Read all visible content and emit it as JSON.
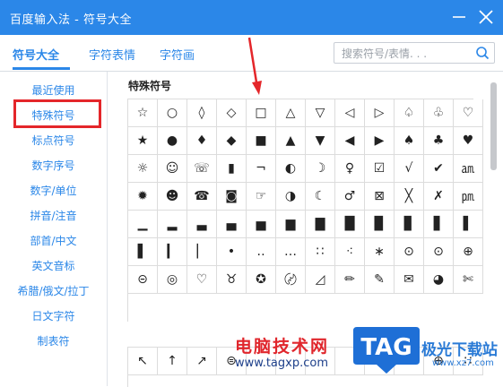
{
  "window": {
    "title": "百度输入法 - 符号大全"
  },
  "tabs": [
    {
      "label": "符号大全"
    },
    {
      "label": "字符表情"
    },
    {
      "label": "字符画"
    }
  ],
  "search": {
    "placeholder": "搜索符号/表情. . ."
  },
  "sidebar": {
    "items": [
      {
        "label": "最近使用"
      },
      {
        "label": "特殊符号"
      },
      {
        "label": "标点符号"
      },
      {
        "label": "数字序号"
      },
      {
        "label": "数字/单位"
      },
      {
        "label": "拼音/注音"
      },
      {
        "label": "部首/中文"
      },
      {
        "label": "英文音标"
      },
      {
        "label": "希腊/俄文/拉丁"
      },
      {
        "label": "日文字符"
      },
      {
        "label": "制表符"
      }
    ]
  },
  "section": {
    "title": "特殊符号"
  },
  "symbols": [
    [
      "☆",
      "○",
      "◊",
      "◇",
      "□",
      "△",
      "▽",
      "◁",
      "▷",
      "♤",
      "♧",
      "♡"
    ],
    [
      "★",
      "●",
      "♦",
      "◆",
      "■",
      "▲",
      "▼",
      "◀",
      "▶",
      "♠",
      "♣",
      "♥"
    ],
    [
      "☼",
      "☺",
      "☏",
      "▮",
      "¬",
      "◐",
      "☽",
      "♀",
      "☑",
      "√",
      "✔",
      "㏂"
    ],
    [
      "✹",
      "☻",
      "☎",
      "◙",
      "☞",
      "◑",
      "☾",
      "♂",
      "⊠",
      "╳",
      "✗",
      "㏘"
    ],
    [
      "▁",
      "▂",
      "▃",
      "▄",
      "▅",
      "▆",
      "▇",
      "█",
      "▉",
      "▊",
      "▋",
      "▌"
    ],
    [
      "▌",
      "▎",
      "▏",
      "•",
      "‥",
      "…",
      "∷",
      "⁖",
      "∗",
      "⊙",
      "⊙",
      "⊕"
    ],
    [
      "⊝",
      "◎",
      "♡",
      "♉",
      "✪",
      "〄",
      "◿",
      "✏",
      "✎",
      "✉",
      "◕",
      "✄"
    ]
  ],
  "symbols_row2": [
    "↖",
    "↑",
    "↗",
    "⊜",
    "",
    "",
    "",
    "",
    "",
    "",
    "⊕",
    "∷"
  ],
  "watermark": {
    "text": "电脑技术网",
    "url": "www.tagxp.com",
    "badge": "TAG",
    "site": "极光下载站",
    "site_url": "www.xz7.com"
  }
}
